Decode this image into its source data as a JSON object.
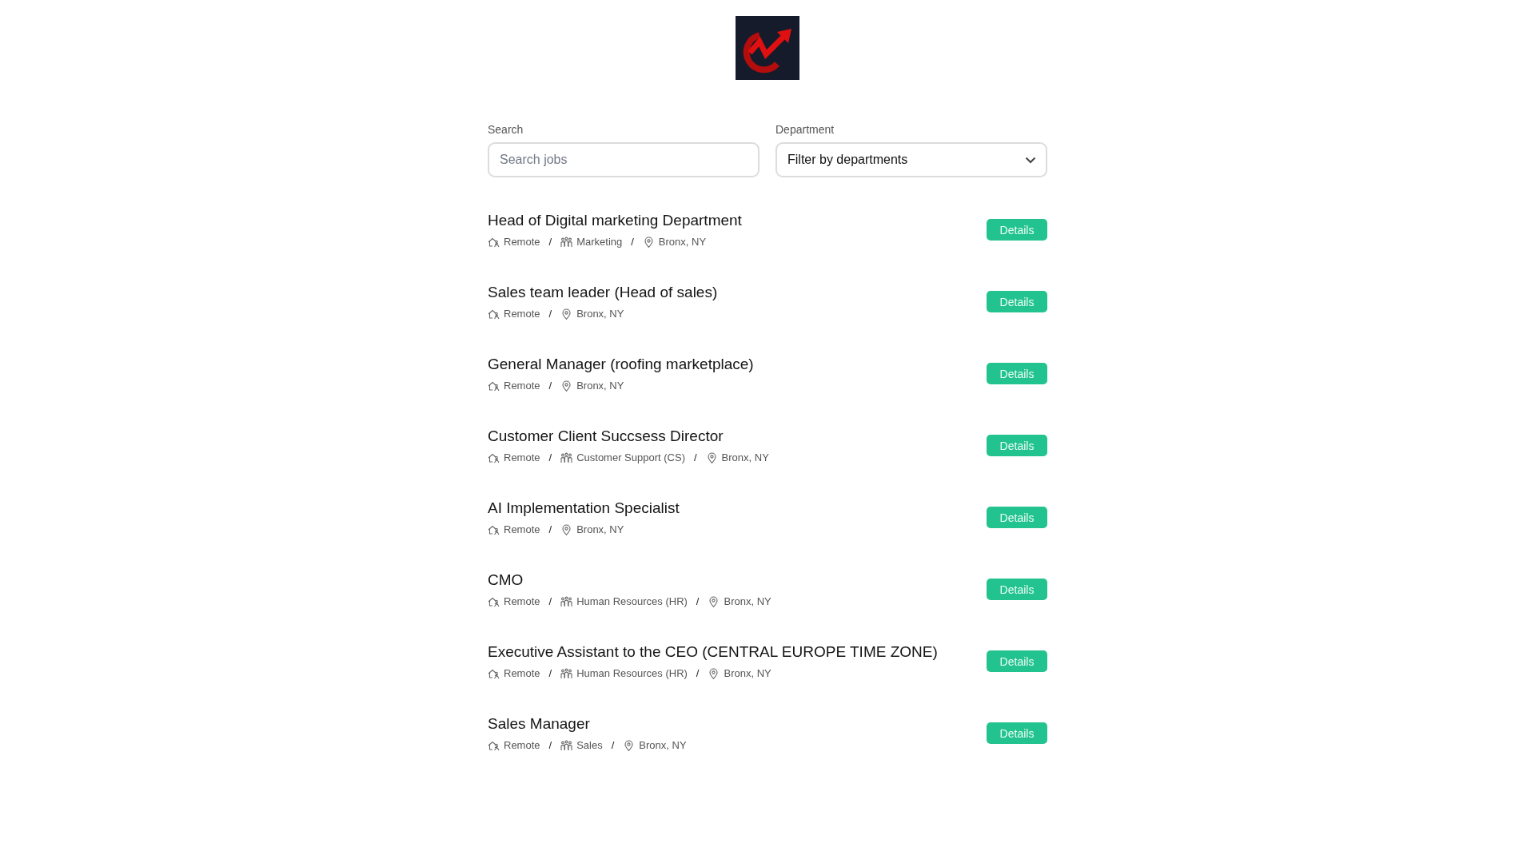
{
  "filters": {
    "search": {
      "label": "Search",
      "placeholder": "Search jobs"
    },
    "department": {
      "label": "Department",
      "value": "Filter by departments"
    }
  },
  "jobs": [
    {
      "title": "Head of Digital marketing Department",
      "meta": [
        {
          "kind": "work_mode",
          "text": "Remote"
        },
        {
          "kind": "separator",
          "text": "/"
        },
        {
          "kind": "department",
          "text": "Marketing"
        },
        {
          "kind": "separator",
          "text": "/"
        },
        {
          "kind": "location",
          "text": "Bronx, NY"
        }
      ],
      "button": "Details"
    },
    {
      "title": "Sales team leader (Head of sales)",
      "meta": [
        {
          "kind": "work_mode",
          "text": "Remote"
        },
        {
          "kind": "separator",
          "text": "/"
        },
        {
          "kind": "location",
          "text": "Bronx, NY"
        }
      ],
      "button": "Details"
    },
    {
      "title": "General Manager (roofing marketplace)",
      "meta": [
        {
          "kind": "work_mode",
          "text": "Remote"
        },
        {
          "kind": "separator",
          "text": "/"
        },
        {
          "kind": "location",
          "text": "Bronx, NY"
        }
      ],
      "button": "Details"
    },
    {
      "title": "Customer Client Succsess Director",
      "meta": [
        {
          "kind": "work_mode",
          "text": "Remote"
        },
        {
          "kind": "separator",
          "text": "/"
        },
        {
          "kind": "department",
          "text": "Customer Support (CS)"
        },
        {
          "kind": "separator",
          "text": "/"
        },
        {
          "kind": "location",
          "text": "Bronx, NY"
        }
      ],
      "button": "Details"
    },
    {
      "title": "AI Implementation Specialist",
      "meta": [
        {
          "kind": "work_mode",
          "text": "Remote"
        },
        {
          "kind": "separator",
          "text": "/"
        },
        {
          "kind": "location",
          "text": "Bronx, NY"
        }
      ],
      "button": "Details"
    },
    {
      "title": "CMO",
      "meta": [
        {
          "kind": "work_mode",
          "text": "Remote"
        },
        {
          "kind": "separator",
          "text": "/"
        },
        {
          "kind": "department",
          "text": "Human Resources (HR)"
        },
        {
          "kind": "separator",
          "text": "/"
        },
        {
          "kind": "location",
          "text": "Bronx, NY"
        }
      ],
      "button": "Details"
    },
    {
      "title": "Executive Assistant to the CEO (CENTRAL EUROPE TIME ZONE)",
      "meta": [
        {
          "kind": "work_mode",
          "text": "Remote"
        },
        {
          "kind": "separator",
          "text": "/"
        },
        {
          "kind": "department",
          "text": "Human Resources (HR)"
        },
        {
          "kind": "separator",
          "text": "/"
        },
        {
          "kind": "location",
          "text": "Bronx, NY"
        }
      ],
      "button": "Details"
    },
    {
      "title": "Sales Manager",
      "meta": [
        {
          "kind": "work_mode",
          "text": "Remote"
        },
        {
          "kind": "separator",
          "text": "/"
        },
        {
          "kind": "department",
          "text": "Sales"
        },
        {
          "kind": "separator",
          "text": "/"
        },
        {
          "kind": "location",
          "text": "Bronx, NY"
        }
      ],
      "button": "Details"
    }
  ]
}
